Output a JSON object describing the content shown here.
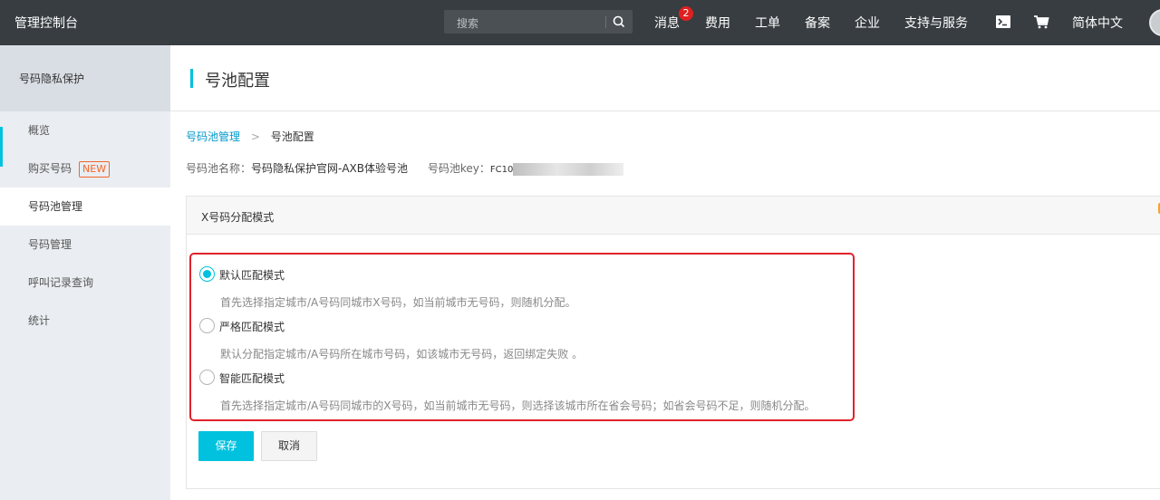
{
  "topbar": {
    "brand": "管理控制台",
    "search_placeholder": "搜索",
    "messages_label": "消息",
    "messages_badge": "2",
    "fees_label": "费用",
    "tickets_label": "工单",
    "filing_label": "备案",
    "enterprise_label": "企业",
    "support_label": "支持与服务",
    "language_label": "简体中文"
  },
  "sidebar": {
    "title": "号码隐私保护",
    "items": [
      {
        "label": "概览"
      },
      {
        "label": "购买号码",
        "tag": "NEW"
      },
      {
        "label": "号码池管理"
      },
      {
        "label": "号码管理"
      },
      {
        "label": "呼叫记录查询"
      },
      {
        "label": "统计"
      }
    ]
  },
  "page": {
    "title": "号池配置",
    "breadcrumb_parent": "号码池管理",
    "breadcrumb_current": "号池配置",
    "pool_name_label": "号码池名称：",
    "pool_name_value": "号码隐私保护官网-AXB体验号池",
    "pool_key_label": "号码池key：",
    "pool_key_visible": "FC10"
  },
  "panel": {
    "heading": "X号码分配模式",
    "options": [
      {
        "label": "默认匹配模式",
        "desc": "首先选择指定城市/A号码同城市X号码，如当前城市无号码，则随机分配。",
        "selected": true
      },
      {
        "label": "严格匹配模式",
        "desc": "默认分配指定城市/A号码所在城市号码，如该城市无号码，返回绑定失败 。",
        "selected": false
      },
      {
        "label": "智能匹配模式",
        "desc": "首先选择指定城市/A号码同城市的X号码，如当前城市无号码，则选择该城市所在省会号码；如省会号码不足，则随机分配。",
        "selected": false
      }
    ],
    "save_label": "保存",
    "cancel_label": "取消"
  },
  "colors": {
    "topbar_bg": "#373d41",
    "accent": "#00c1de",
    "highlight_box": "#e0222a",
    "new_tag": "#f5662b"
  }
}
